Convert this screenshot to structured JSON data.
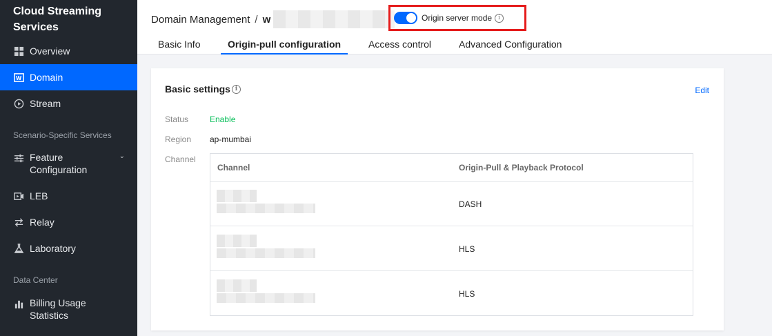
{
  "sidebar": {
    "brand": "Cloud Streaming Services",
    "items": [
      {
        "label": "Overview",
        "icon": "grid-icon"
      },
      {
        "label": "Domain",
        "icon": "domain-icon",
        "active": true
      },
      {
        "label": "Stream",
        "icon": "stream-icon"
      },
      {
        "label": "Feature Configuration",
        "icon": "sliders-icon",
        "expandable": true
      },
      {
        "label": "LEB",
        "icon": "leb-icon"
      },
      {
        "label": "Relay",
        "icon": "relay-icon"
      },
      {
        "label": "Laboratory",
        "icon": "flask-icon"
      },
      {
        "label": "Billing Usage Statistics",
        "icon": "bar-chart-icon"
      }
    ],
    "sections": {
      "scenario": "Scenario-Specific Services",
      "data_center": "Data Center"
    }
  },
  "header": {
    "breadcrumb_root": "Domain Management",
    "breadcrumb_sep": "/",
    "breadcrumb_domain_prefix": "w",
    "origin_mode_label": "Origin server mode",
    "origin_mode_on": true
  },
  "tabs": [
    {
      "label": "Basic Info"
    },
    {
      "label": "Origin-pull configuration",
      "active": true
    },
    {
      "label": "Access control"
    },
    {
      "label": "Advanced Configuration"
    }
  ],
  "card": {
    "title": "Basic settings",
    "edit_label": "Edit",
    "fields": {
      "status_label": "Status",
      "status_value": "Enable",
      "region_label": "Region",
      "region_value": "ap-mumbai",
      "channel_label": "Channel"
    },
    "table": {
      "headers": [
        "Channel",
        "Origin-Pull & Playback Protocol"
      ],
      "rows": [
        {
          "protocol": "DASH"
        },
        {
          "protocol": "HLS"
        },
        {
          "protocol": "HLS"
        }
      ]
    }
  },
  "colors": {
    "sidebar_bg": "#22272e",
    "accent": "#0068ff",
    "highlight_box": "#e51c1c",
    "enable_green": "#0abf5b"
  }
}
